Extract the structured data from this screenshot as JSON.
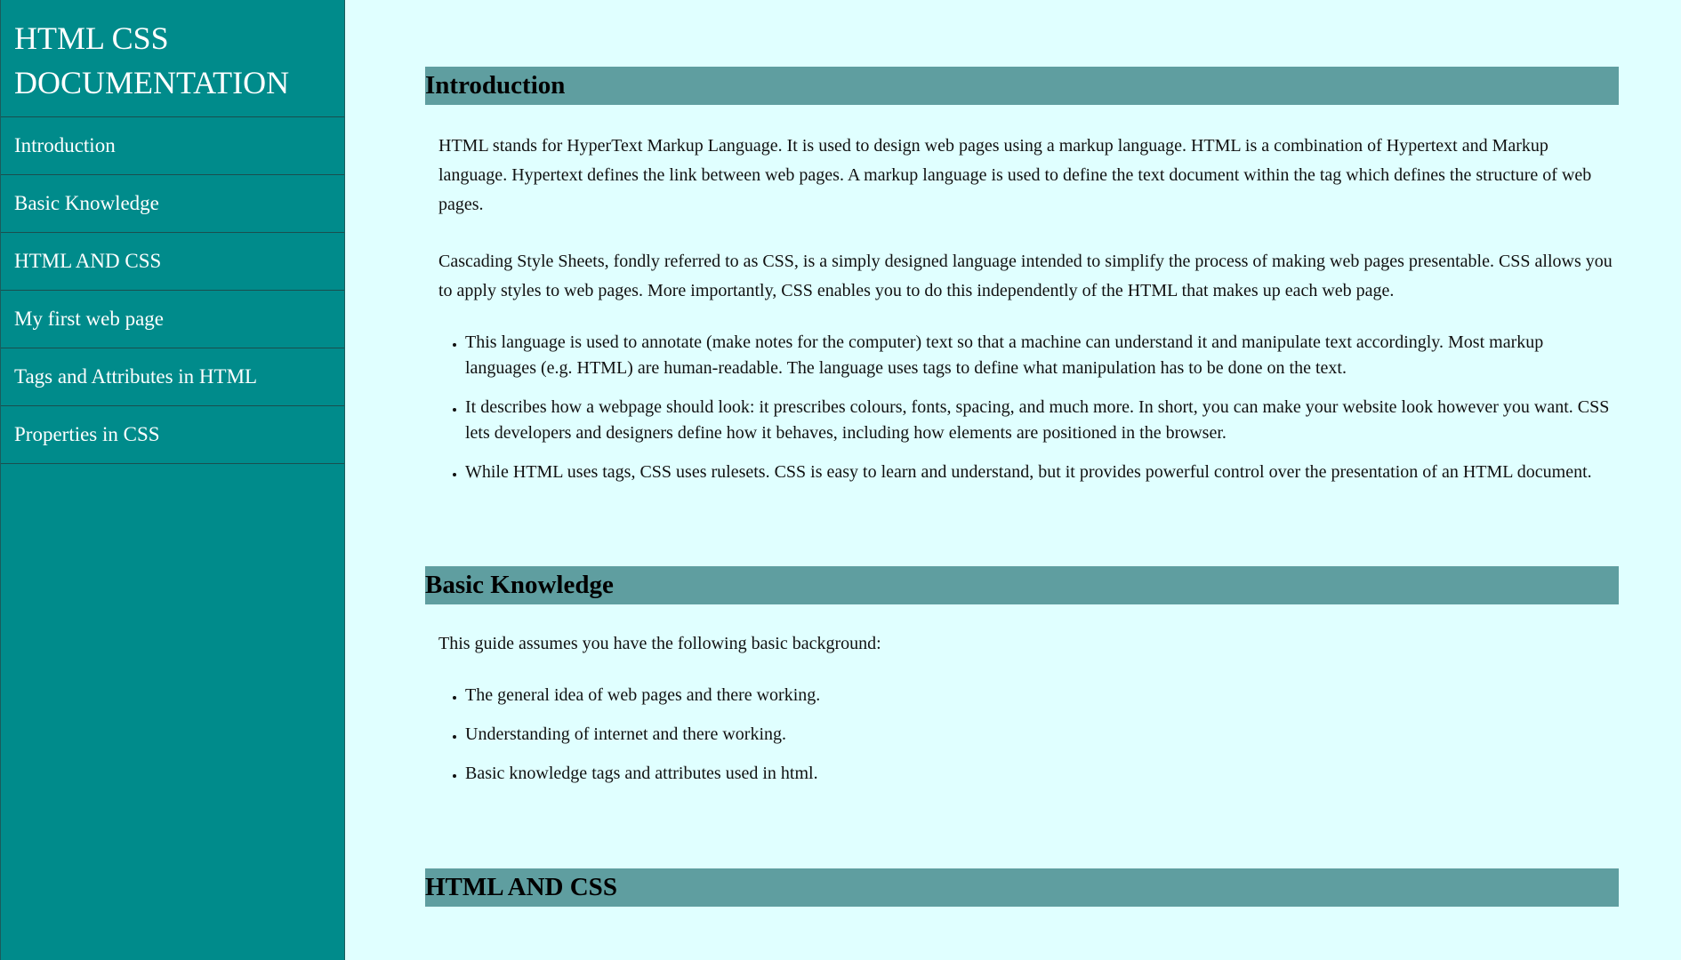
{
  "navbar": {
    "title": "HTML CSS DOCUMENTATION",
    "links": [
      "Introduction",
      "Basic Knowledge",
      "HTML AND CSS",
      "My first web page",
      "Tags and Attributes in HTML",
      "Properties in CSS"
    ]
  },
  "sections": {
    "introduction": {
      "title": "Introduction",
      "p1": "HTML stands for HyperText Markup Language. It is used to design web pages using a markup language. HTML is a combination of Hypertext and Markup language. Hypertext defines the link between web pages. A markup language is used to define the text document within the tag which defines the structure of web pages.",
      "p2": "Cascading Style Sheets, fondly referred to as CSS, is a simply designed language intended to simplify the process of making web pages presentable. CSS allows you to apply styles to web pages. More importantly, CSS enables you to do this independently of the HTML that makes up each web page.",
      "bullets": [
        "This language is used to annotate (make notes for the computer) text so that a machine can understand it and manipulate text accordingly. Most markup languages (e.g. HTML) are human-readable. The language uses tags to define what manipulation has to be done on the text.",
        "It describes how a webpage should look: it prescribes colours, fonts, spacing, and much more. In short, you can make your website look however you want. CSS lets developers and designers define how it behaves, including how elements are positioned in the browser.",
        "While HTML uses tags, CSS uses rulesets. CSS is easy to learn and understand, but it provides powerful control over the presentation of an HTML document."
      ]
    },
    "basic": {
      "title": "Basic Knowledge",
      "p1": "This guide assumes you have the following basic background:",
      "bullets": [
        "The general idea of web pages and there working.",
        "Understanding of internet and there working.",
        "Basic knowledge tags and attributes used in html."
      ]
    },
    "htmlcss": {
      "title": "HTML AND CSS"
    }
  },
  "colors": {
    "sidebar": "#008b8b",
    "page_background": "#e0ffff",
    "section_header": "#5f9ea0"
  }
}
